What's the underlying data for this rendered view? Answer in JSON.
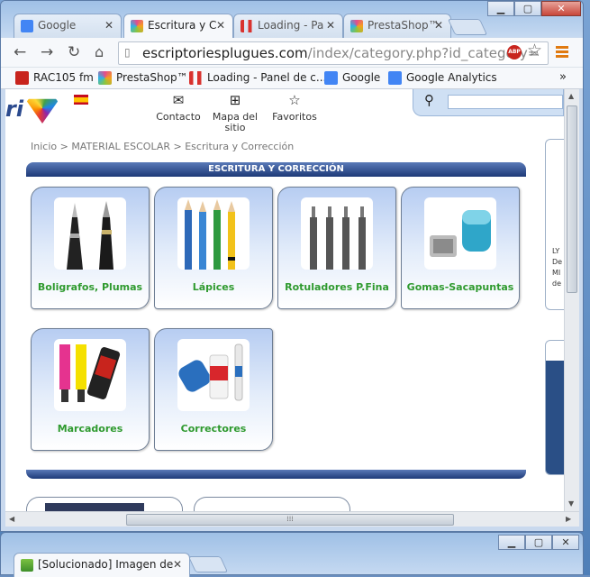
{
  "browser": {
    "tabs": [
      {
        "title": "Google",
        "favicon": "google-g-icon",
        "color": "#4285f4"
      },
      {
        "title": "Escritura y C",
        "favicon": "prestashop-icon",
        "color": "#e44b8d"
      },
      {
        "title": "Loading - Pa",
        "favicon": "loading-bars-icon",
        "color": "#d9322e"
      },
      {
        "title": "PrestaShop™",
        "favicon": "prestashop-icon",
        "color": "#e44b8d"
      }
    ],
    "url_host": "escriptoriesplugues.com",
    "url_path": "/index/category.php?id_category=",
    "bookmarks": [
      {
        "label": "RAC105 fm",
        "icon": "rac105-icon",
        "color": "#c8241d"
      },
      {
        "label": "PrestaShop™",
        "icon": "prestashop-icon",
        "color": "#e44b8d"
      },
      {
        "label": "Loading - Panel de c...",
        "icon": "loading-bars-icon",
        "color": "#d9322e"
      },
      {
        "label": "Google",
        "icon": "google-g-icon",
        "color": "#4285f4"
      },
      {
        "label": "Google Analytics",
        "icon": "google-g-icon",
        "color": "#4285f4"
      }
    ],
    "bookmarks_overflow": "»",
    "abp_label": "ABP"
  },
  "page": {
    "logo_text": "ri",
    "top_links": [
      "Contacto",
      "Mapa del sitio",
      "Favoritos"
    ],
    "breadcrumb": "Inicio  >  MATERIAL ESCOLAR  >  Escritura y Corrección",
    "category_title": "ESCRITURA Y CORRECCIÓN",
    "subcategories": [
      {
        "label": "Boligrafos, Plumas"
      },
      {
        "label": "Lápices"
      },
      {
        "label": "Rotuladores P.Fina"
      },
      {
        "label": "Gomas-Sacapuntas"
      },
      {
        "label": "Marcadores"
      },
      {
        "label": "Correctores"
      }
    ],
    "side_text": [
      "LY",
      "De",
      "MI",
      "de"
    ]
  },
  "second_window": {
    "tab_title": "[Solucionado] Imagen de"
  }
}
